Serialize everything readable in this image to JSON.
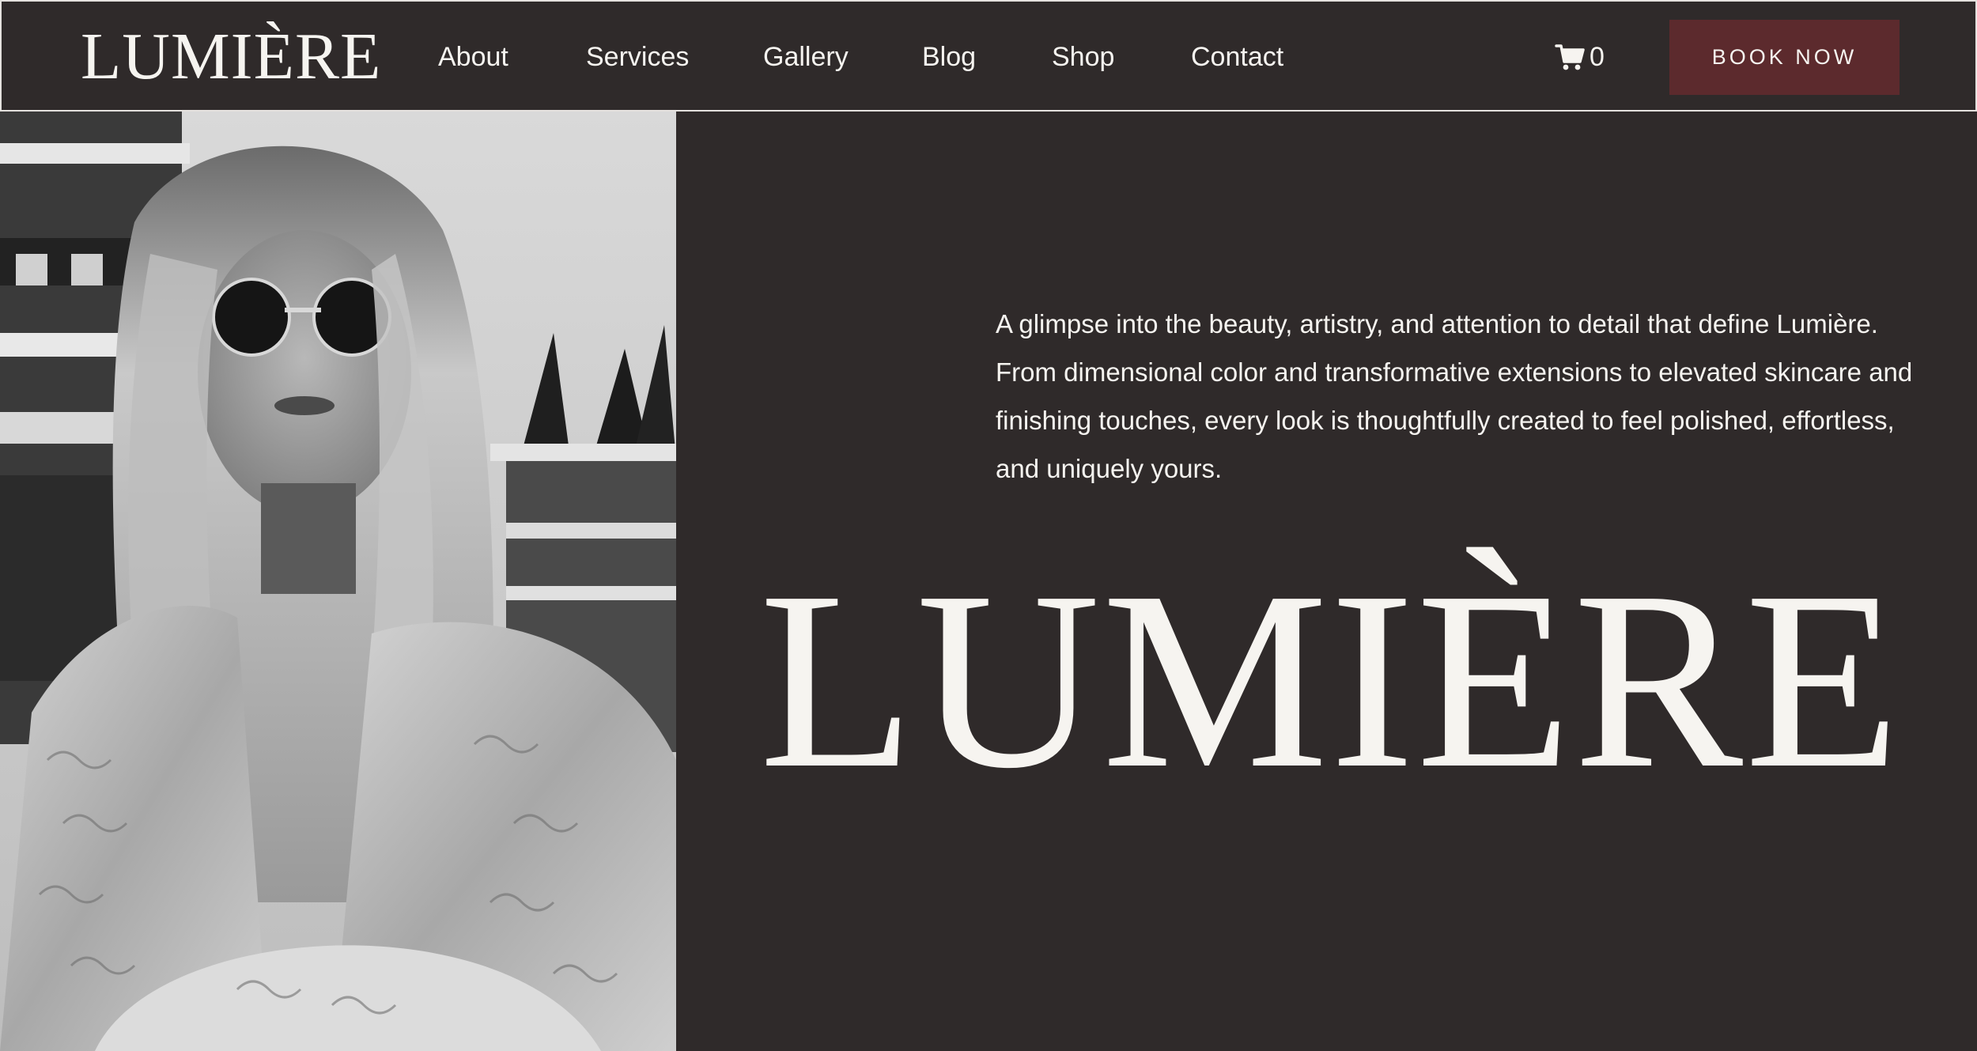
{
  "header": {
    "logo": "LUMIÈRE",
    "nav": {
      "about": "About",
      "services": "Services",
      "gallery": "Gallery",
      "blog": "Blog",
      "shop": "Shop",
      "contact": "Contact"
    },
    "cart": {
      "icon": "cart-icon",
      "count": "0"
    },
    "book_button": "BOOK NOW"
  },
  "hero": {
    "image_alt": "black and white portrait",
    "intro": "A glimpse into the beauty, artistry, and attention to detail that define Lumière. From dimensional color and transformative extensions to elevated skincare and finishing touches, every look is thoughtfully created to feel polished, effortless, and uniquely yours.",
    "title": "LUMIÈRE"
  },
  "colors": {
    "background": "#2f2a2a",
    "text": "#f6f4f0",
    "accent": "#5c2a2d",
    "border": "#e4e1de"
  }
}
